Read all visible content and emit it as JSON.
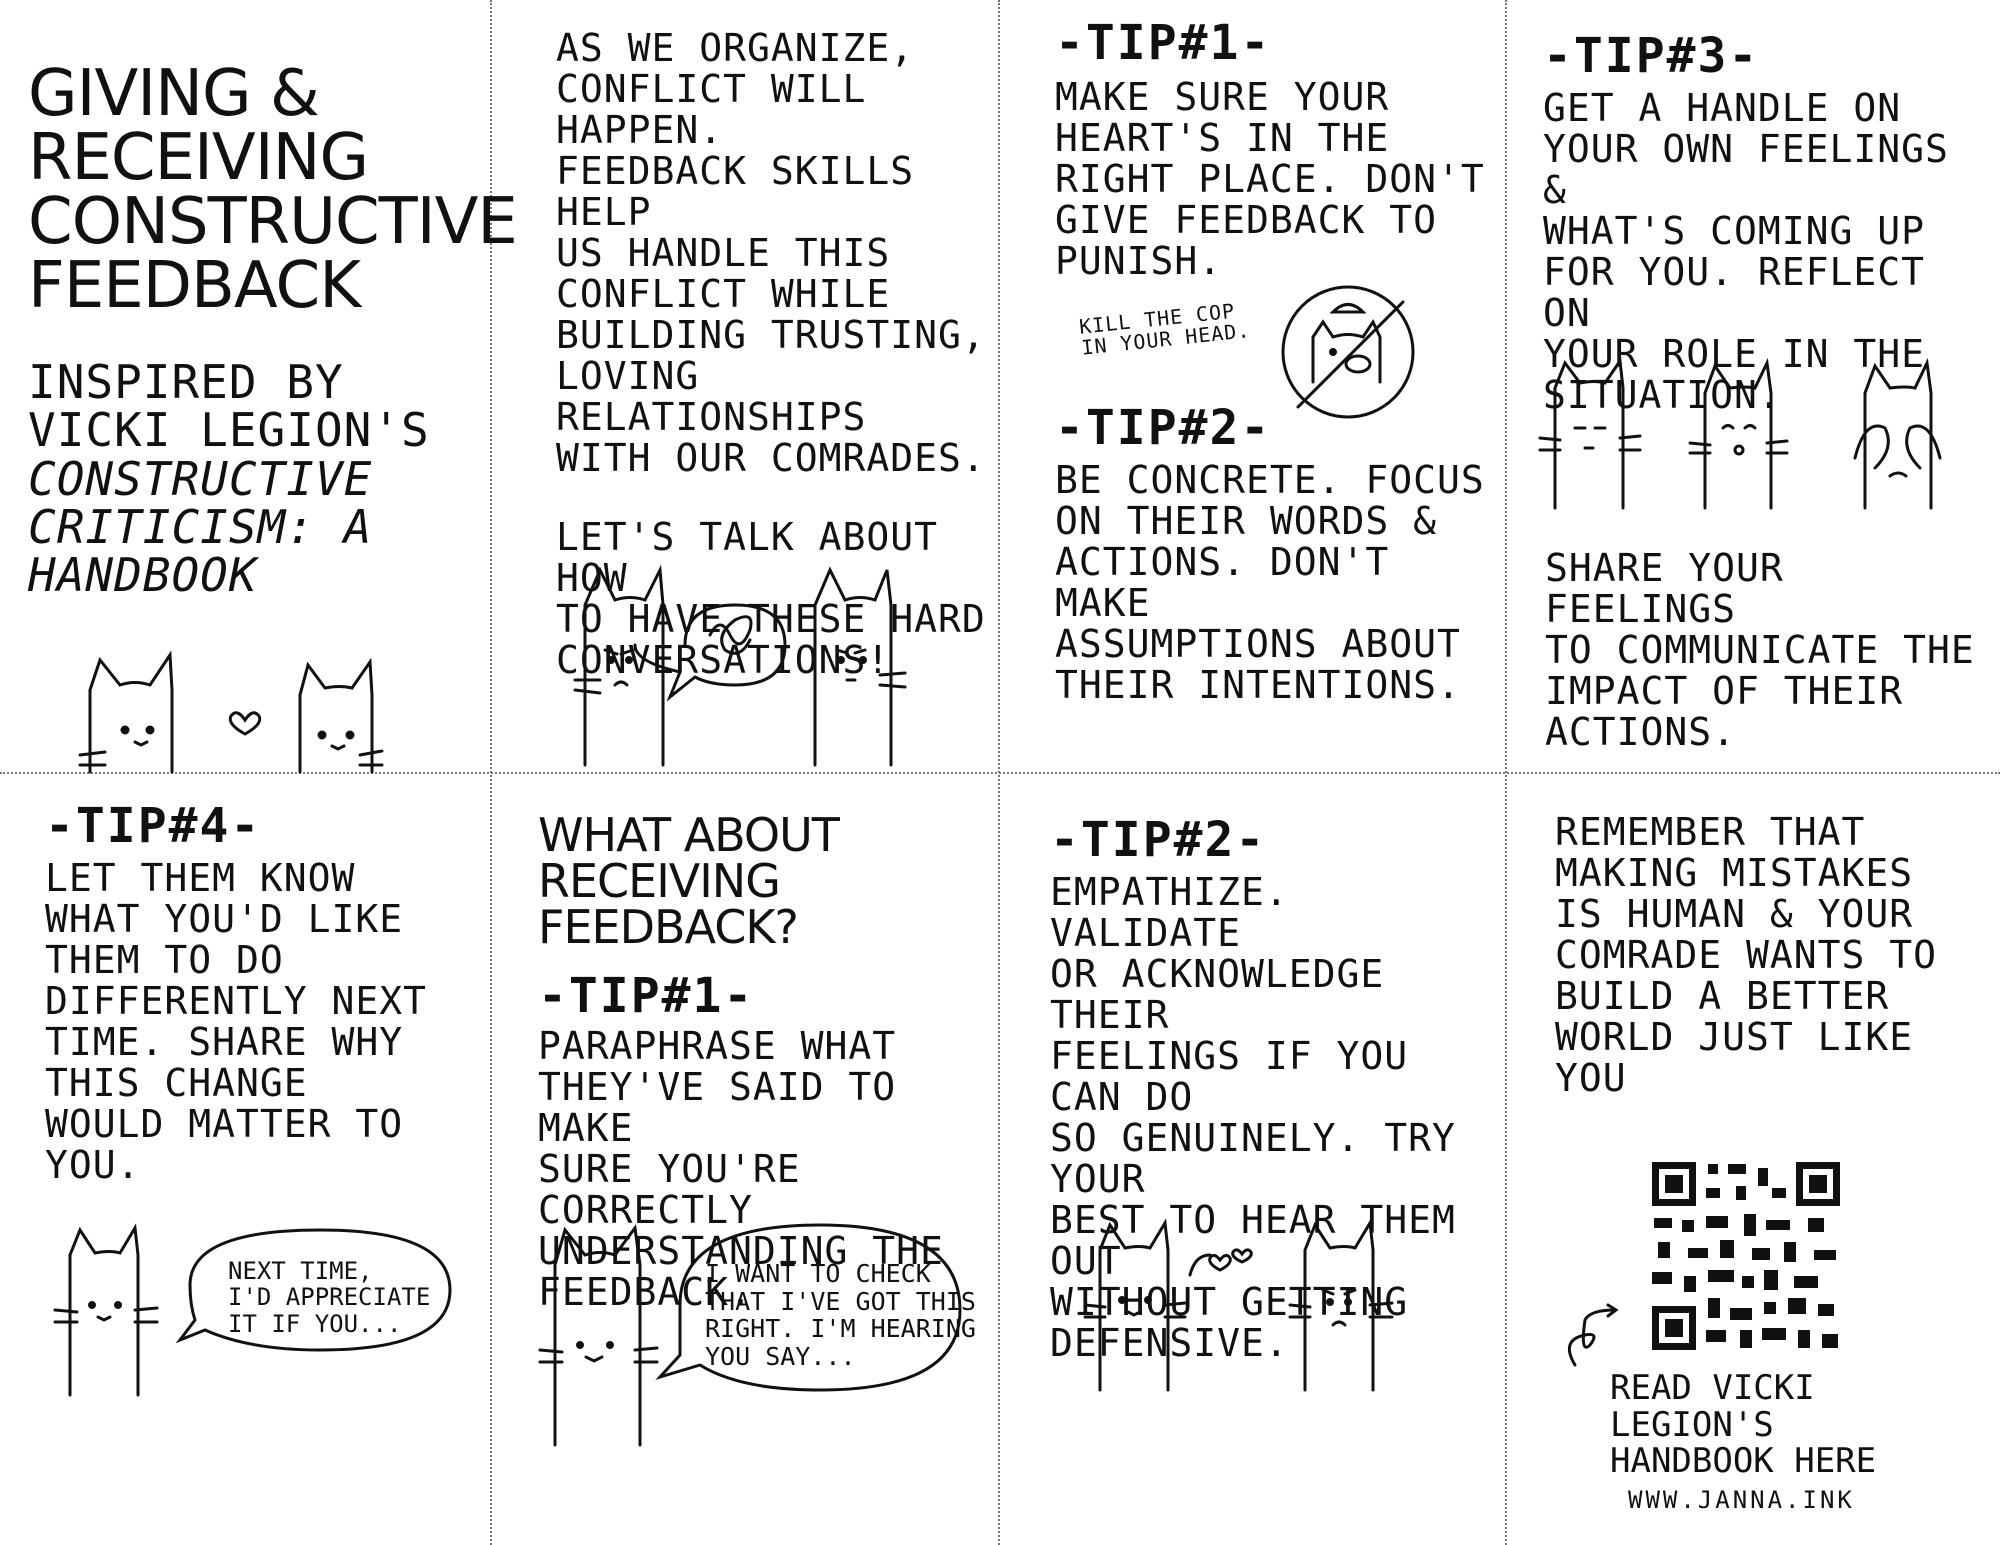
{
  "panels": {
    "p1": {
      "title": "GIVING &\nRECEIVING\nCONSTRUCTIVE\nFEEDBACK",
      "inspired": "INSPIRED BY\nVICKI LEGION'S",
      "book": "CONSTRUCTIVE\nCRITICISM: A\nHANDBOOK"
    },
    "p2": {
      "intro": "AS WE ORGANIZE,\nCONFLICT WILL HAPPEN.\nFEEDBACK SKILLS HELP\nUS HANDLE THIS\nCONFLICT WHILE\nBUILDING TRUSTING,\nLOVING RELATIONSHIPS\nWITH OUR COMRADES.",
      "talk": "LET'S TALK ABOUT HOW\nTO HAVE THESE HARD\nCONVERSATIONS!"
    },
    "p3": {
      "tip1_heading": "-TIP#1-",
      "tip1_text": "MAKE SURE YOUR\nHEART'S IN THE\nRIGHT PLACE. DON'T\nGIVE FEEDBACK TO\nPUNISH.",
      "cop_note": "KILL THE COP\nIN YOUR HEAD.",
      "tip2_heading": "-TIP#2-",
      "tip2_text": "BE CONCRETE. FOCUS\nON THEIR WORDS &\nACTIONS. DON'T MAKE\nASSUMPTIONS ABOUT\nTHEIR INTENTIONS."
    },
    "p4": {
      "tip3_heading": "-TIP#3-",
      "tip3_text": "GET A HANDLE ON\nYOUR OWN FEELINGS &\nWHAT'S COMING UP\nFOR YOU. REFLECT ON\nYOUR ROLE IN THE\nSITUATION.",
      "share_text": "SHARE YOUR FEELINGS\nTO COMMUNICATE THE\nIMPACT OF THEIR\nACTIONS."
    },
    "p5": {
      "tip4_heading": "-TIP#4-",
      "tip4_text": "LET THEM KNOW\nWHAT YOU'D LIKE\nTHEM TO DO\nDIFFERENTLY NEXT\nTIME. SHARE WHY\nTHIS CHANGE\nWOULD MATTER TO\nYOU.",
      "bubble": "NEXT TIME,\nI'D APPRECIATE\nIT IF YOU..."
    },
    "p6": {
      "heading": "WHAT ABOUT\nRECEIVING FEEDBACK?",
      "tip1_heading": "-TIP#1-",
      "tip1_text": "PARAPHRASE WHAT\nTHEY'VE SAID TO MAKE\nSURE YOU'RE CORRECTLY\nUNDERSTANDING THE\nFEEDBACK.",
      "bubble": "I WANT TO CHECK\nTHAT I'VE GOT THIS\nRIGHT. I'M HEARING\nYOU SAY..."
    },
    "p7": {
      "tip2_heading": "-TIP#2-",
      "tip2_text": "EMPATHIZE. VALIDATE\nOR ACKNOWLEDGE THEIR\nFEELINGS IF YOU CAN DO\nSO GENUINELY. TRY YOUR\nBEST TO HEAR THEM OUT\nWITHOUT GETTING\nDEFENSIVE."
    },
    "p8": {
      "remember": "REMEMBER THAT\nMAKING MISTAKES\nIS HUMAN & YOUR\nCOMRADE WANTS TO\nBUILD A BETTER\nWORLD JUST LIKE YOU",
      "read": "READ VICKI LEGION'S\nHANDBOOK HERE",
      "url": "WWW.JANNA.INK"
    }
  },
  "icons": [
    "cat-icon",
    "heart-icon",
    "speech-bubble-icon",
    "no-pig-cop-icon",
    "qr-code-icon",
    "arrow-icon"
  ]
}
